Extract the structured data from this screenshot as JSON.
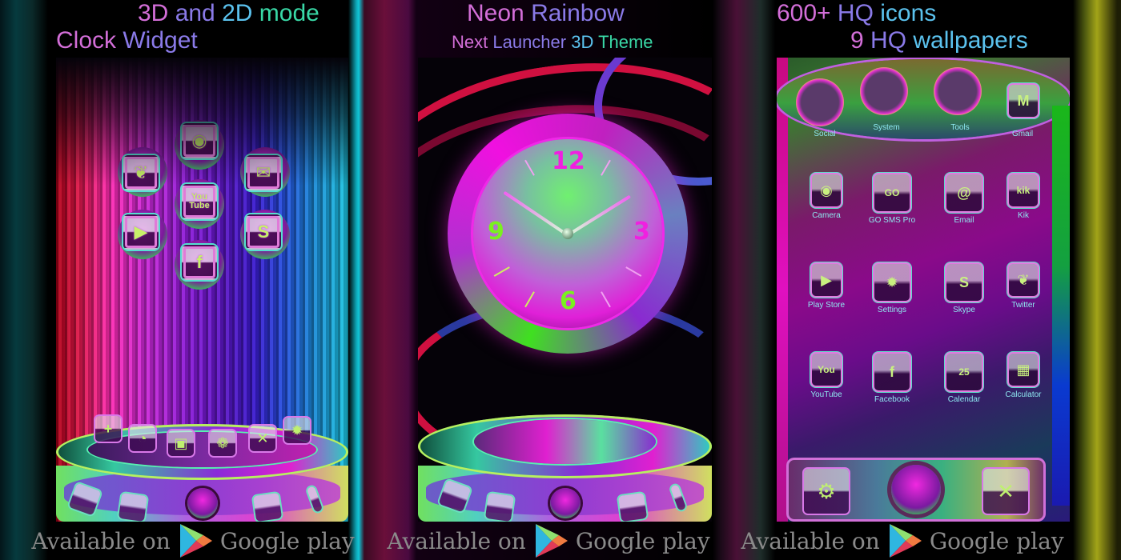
{
  "headings": {
    "left_line1": "3D and 2D mode",
    "left_line2": "Clock Widget",
    "center_title": "Neon Rainbow",
    "center_subtitle": "Next Launcher 3D Theme",
    "right_line1": "600+ HQ icons",
    "right_line2": "9 HQ wallpapers"
  },
  "panel1": {
    "icons": [
      "twitter-icon",
      "camera-icon",
      "gmail-icon",
      "youtube-icon",
      "play-store-icon",
      "skype-icon",
      "facebook-icon"
    ],
    "youtube_text_top": "You",
    "youtube_text_bottom": "Tube",
    "facebook_glyph": "f",
    "skype_glyph": "S",
    "platform_icons": [
      "add-icon",
      "speedometer-icon",
      "wallpaper-icon",
      "palette-icon",
      "tools-icon",
      "settings-gear-icon"
    ],
    "dock_icons": [
      "phone-icon",
      "contacts-icon",
      "home-ball",
      "messaging-icon",
      "menu-icon"
    ]
  },
  "panel2": {
    "clock": {
      "numerals": {
        "n12": "12",
        "n3": "3",
        "n6": "6",
        "n9": "9"
      },
      "time": "10:10"
    },
    "dock_icons": [
      "phone-icon",
      "contacts-icon",
      "home-ball",
      "messaging-icon",
      "menu-icon"
    ]
  },
  "panel3": {
    "folders": [
      {
        "label": "Social"
      },
      {
        "label": "System"
      },
      {
        "label": "Tools"
      }
    ],
    "top_apps": [
      {
        "label": "Gmail",
        "glyph": "M"
      }
    ],
    "grid": [
      {
        "label": "Camera",
        "glyph": "◉"
      },
      {
        "label": "GO SMS Pro",
        "glyph": "GO"
      },
      {
        "label": "Email",
        "glyph": "@"
      },
      {
        "label": "Kik",
        "glyph": "kik"
      },
      {
        "label": "Play Store",
        "glyph": "▶"
      },
      {
        "label": "Settings",
        "glyph": "✹"
      },
      {
        "label": "Skype",
        "glyph": "S"
      },
      {
        "label": "Twitter",
        "glyph": "❦"
      },
      {
        "label": "YouTube",
        "glyph": "You"
      },
      {
        "label": "Facebook",
        "glyph": "f"
      },
      {
        "label": "Calendar",
        "glyph": "25"
      },
      {
        "label": "Calculator",
        "glyph": "▦"
      }
    ],
    "dock_icons": [
      "android-settings-icon",
      "home-ball",
      "tools-wrench-screwdriver-icon"
    ]
  },
  "footer": {
    "available_on": "Available on",
    "store_name": "Google play"
  },
  "colors": {
    "rainbow": [
      "#d36ed8",
      "#8a7ae8",
      "#5bc2ee",
      "#39d8a6",
      "#b9e47e",
      "#e8c86d",
      "#d76ea6"
    ],
    "footer_text": "#8a8a8a",
    "label_text": "#8ee8f0"
  }
}
